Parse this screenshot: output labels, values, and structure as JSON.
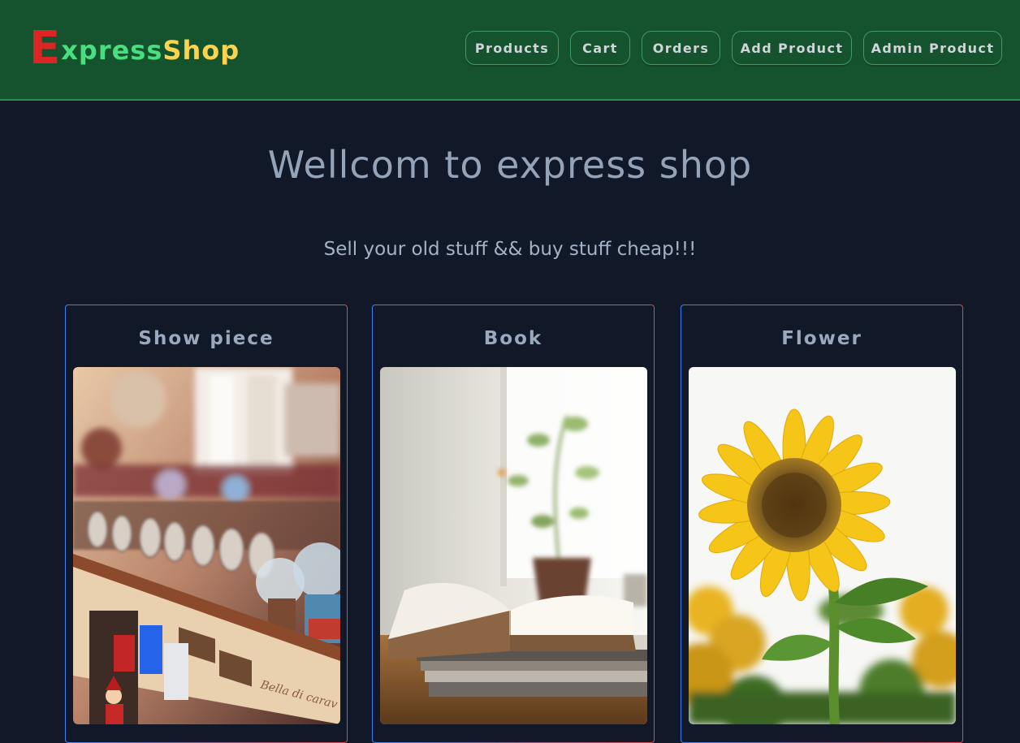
{
  "logo": {
    "first_letter": "E",
    "part1": "xpress",
    "part2": "Shop"
  },
  "nav": {
    "products": "Products",
    "cart": "Cart",
    "orders": "Orders",
    "add_product": "Add Product",
    "admin_product": "Admin Product"
  },
  "hero": {
    "title": "Wellcom to express shop",
    "subtitle": "Sell your old stuff && buy stuff cheap!!!"
  },
  "categories": [
    {
      "title": "Show piece",
      "image": "souvenir-shelf-photo"
    },
    {
      "title": "Book",
      "image": "open-book-photo"
    },
    {
      "title": "Flower",
      "image": "sunflower-photo"
    }
  ],
  "colors": {
    "navbar_bg": "#14532d",
    "page_bg": "#111827",
    "logo_e": "#dc2626",
    "logo_green": "#4ade80",
    "logo_yellow": "#fcd34d"
  }
}
